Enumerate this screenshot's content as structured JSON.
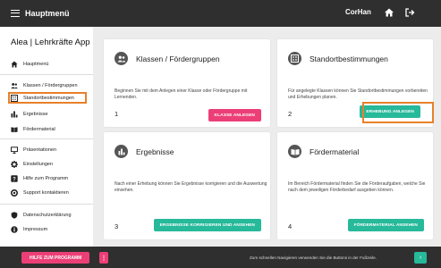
{
  "topbar": {
    "menu_label": "Hauptmenü",
    "username": "CorHan"
  },
  "sidebar": {
    "app_title": "Alea | Lehrkräfte App",
    "items": [
      {
        "label": "Hauptmenü",
        "icon": "home-icon"
      },
      {
        "label": "Klassen / Fördergruppen",
        "icon": "users-icon"
      },
      {
        "label": "Standortbestimmungen",
        "icon": "assessment-icon"
      },
      {
        "label": "Ergebnisse",
        "icon": "bar-chart-icon"
      },
      {
        "label": "Fördermaterial",
        "icon": "book-icon"
      },
      {
        "label": "Präsentationen",
        "icon": "monitor-icon"
      },
      {
        "label": "Einstellungen",
        "icon": "gear-icon"
      },
      {
        "label": "Hilfe zum Programm",
        "icon": "help-icon"
      },
      {
        "label": "Support kontaktieren",
        "icon": "support-icon"
      },
      {
        "label": "Datenschutzerklärung",
        "icon": "shield-icon"
      },
      {
        "label": "Impressum",
        "icon": "info-icon"
      }
    ]
  },
  "cards": [
    {
      "title": "Klassen / Fördergruppen",
      "text": "Beginnen Sie mit dem Anlegen einer Klasse oder Fördergruppe mit Lernenden.",
      "number": "1",
      "button": "KLASSE ANLEGEN",
      "button_color": "#ec3f78",
      "icon": "users-icon"
    },
    {
      "title": "Standortbestimmungen",
      "text": "Für angelegte Klassen können Sie Standortbestimmungen vorbereiten und Erhebungen planen.",
      "number": "2",
      "button": "ERHEBUNG ANLEGEN",
      "button_color": "#26b99a",
      "icon": "assessment-icon"
    },
    {
      "title": "Ergebnisse",
      "text": "Nach einer Erhebung können Sie Ergebnisse korrigieren und die Auswertung einsehen.",
      "number": "3",
      "button": "ERGEBNISSE KORRIGIEREN UND ANSEHEN",
      "button_color": "#26b99a",
      "icon": "bar-chart-icon"
    },
    {
      "title": "Fördermaterial",
      "text": "Im Bereich Fördermaterial finden Sie die Förderaufgaben, welche Sie nach dem jeweiligen Förderbedarf ausgeben können.",
      "number": "4",
      "button": "FÖRDERMATERIAL ANSEHEN",
      "button_color": "#26b99a",
      "icon": "book-icon"
    }
  ],
  "bottombar": {
    "help_button": "HILFE ZUM PROGRAMM",
    "more_button": "⋮",
    "hint": "Zum schnellen Navigieren verwenden Sie die Buttons in der Fußzeile.",
    "next_button": "›"
  },
  "colors": {
    "accent_pink": "#ec3f78",
    "accent_teal": "#26b99a",
    "highlight_orange": "#e8802a",
    "bar_dark": "#2f2f2f"
  }
}
